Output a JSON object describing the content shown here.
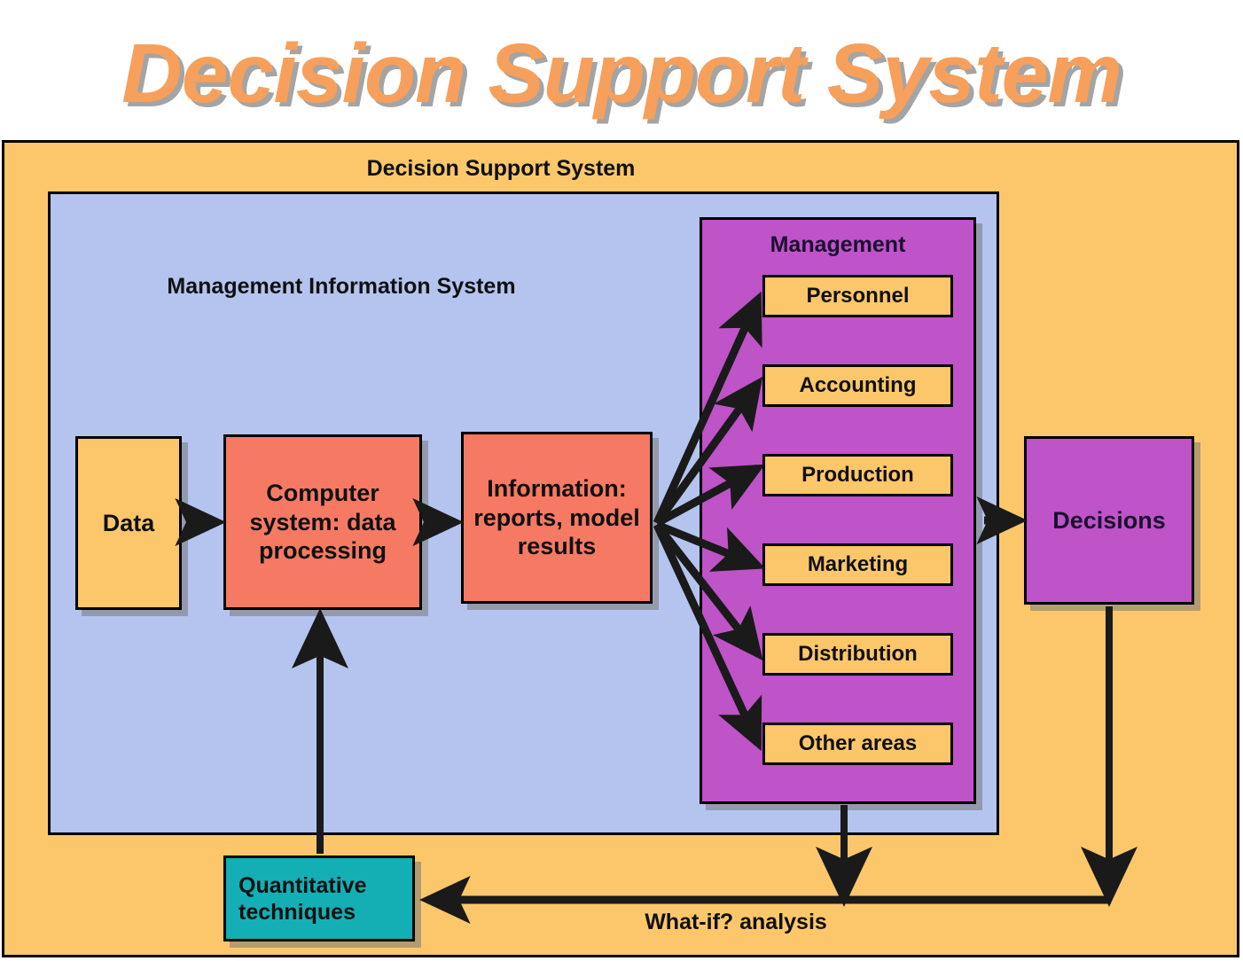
{
  "title": "Decision Support System",
  "outer_panel": {
    "label": "Decision Support System"
  },
  "mis_panel": {
    "label": "Management Information System"
  },
  "management_panel": {
    "label": "Management",
    "departments": [
      {
        "label": "Personnel"
      },
      {
        "label": "Accounting"
      },
      {
        "label": "Production"
      },
      {
        "label": "Marketing"
      },
      {
        "label": "Distribution"
      },
      {
        "label": "Other areas"
      }
    ]
  },
  "boxes": {
    "data": "Data",
    "computer_system": "Computer system: data processing",
    "information": "Information: reports, model results",
    "decisions": "Decisions",
    "quantitative": "Quantitative techniques"
  },
  "annotations": {
    "what_if": "What-if? analysis"
  },
  "colors": {
    "title_text": "#F6A05C",
    "outer_panel_bg": "#FCC76B",
    "mis_panel_bg": "#B4C4EF",
    "management_panel_bg": "#BF53C8",
    "process_box_bg": "#F67A63",
    "data_box_bg": "#FCC76B",
    "department_box_bg": "#FCC76B",
    "decisions_box_bg": "#BF53C8",
    "quantitative_box_bg": "#13AFB5",
    "outline": "#000000",
    "shadow": "#787878"
  }
}
